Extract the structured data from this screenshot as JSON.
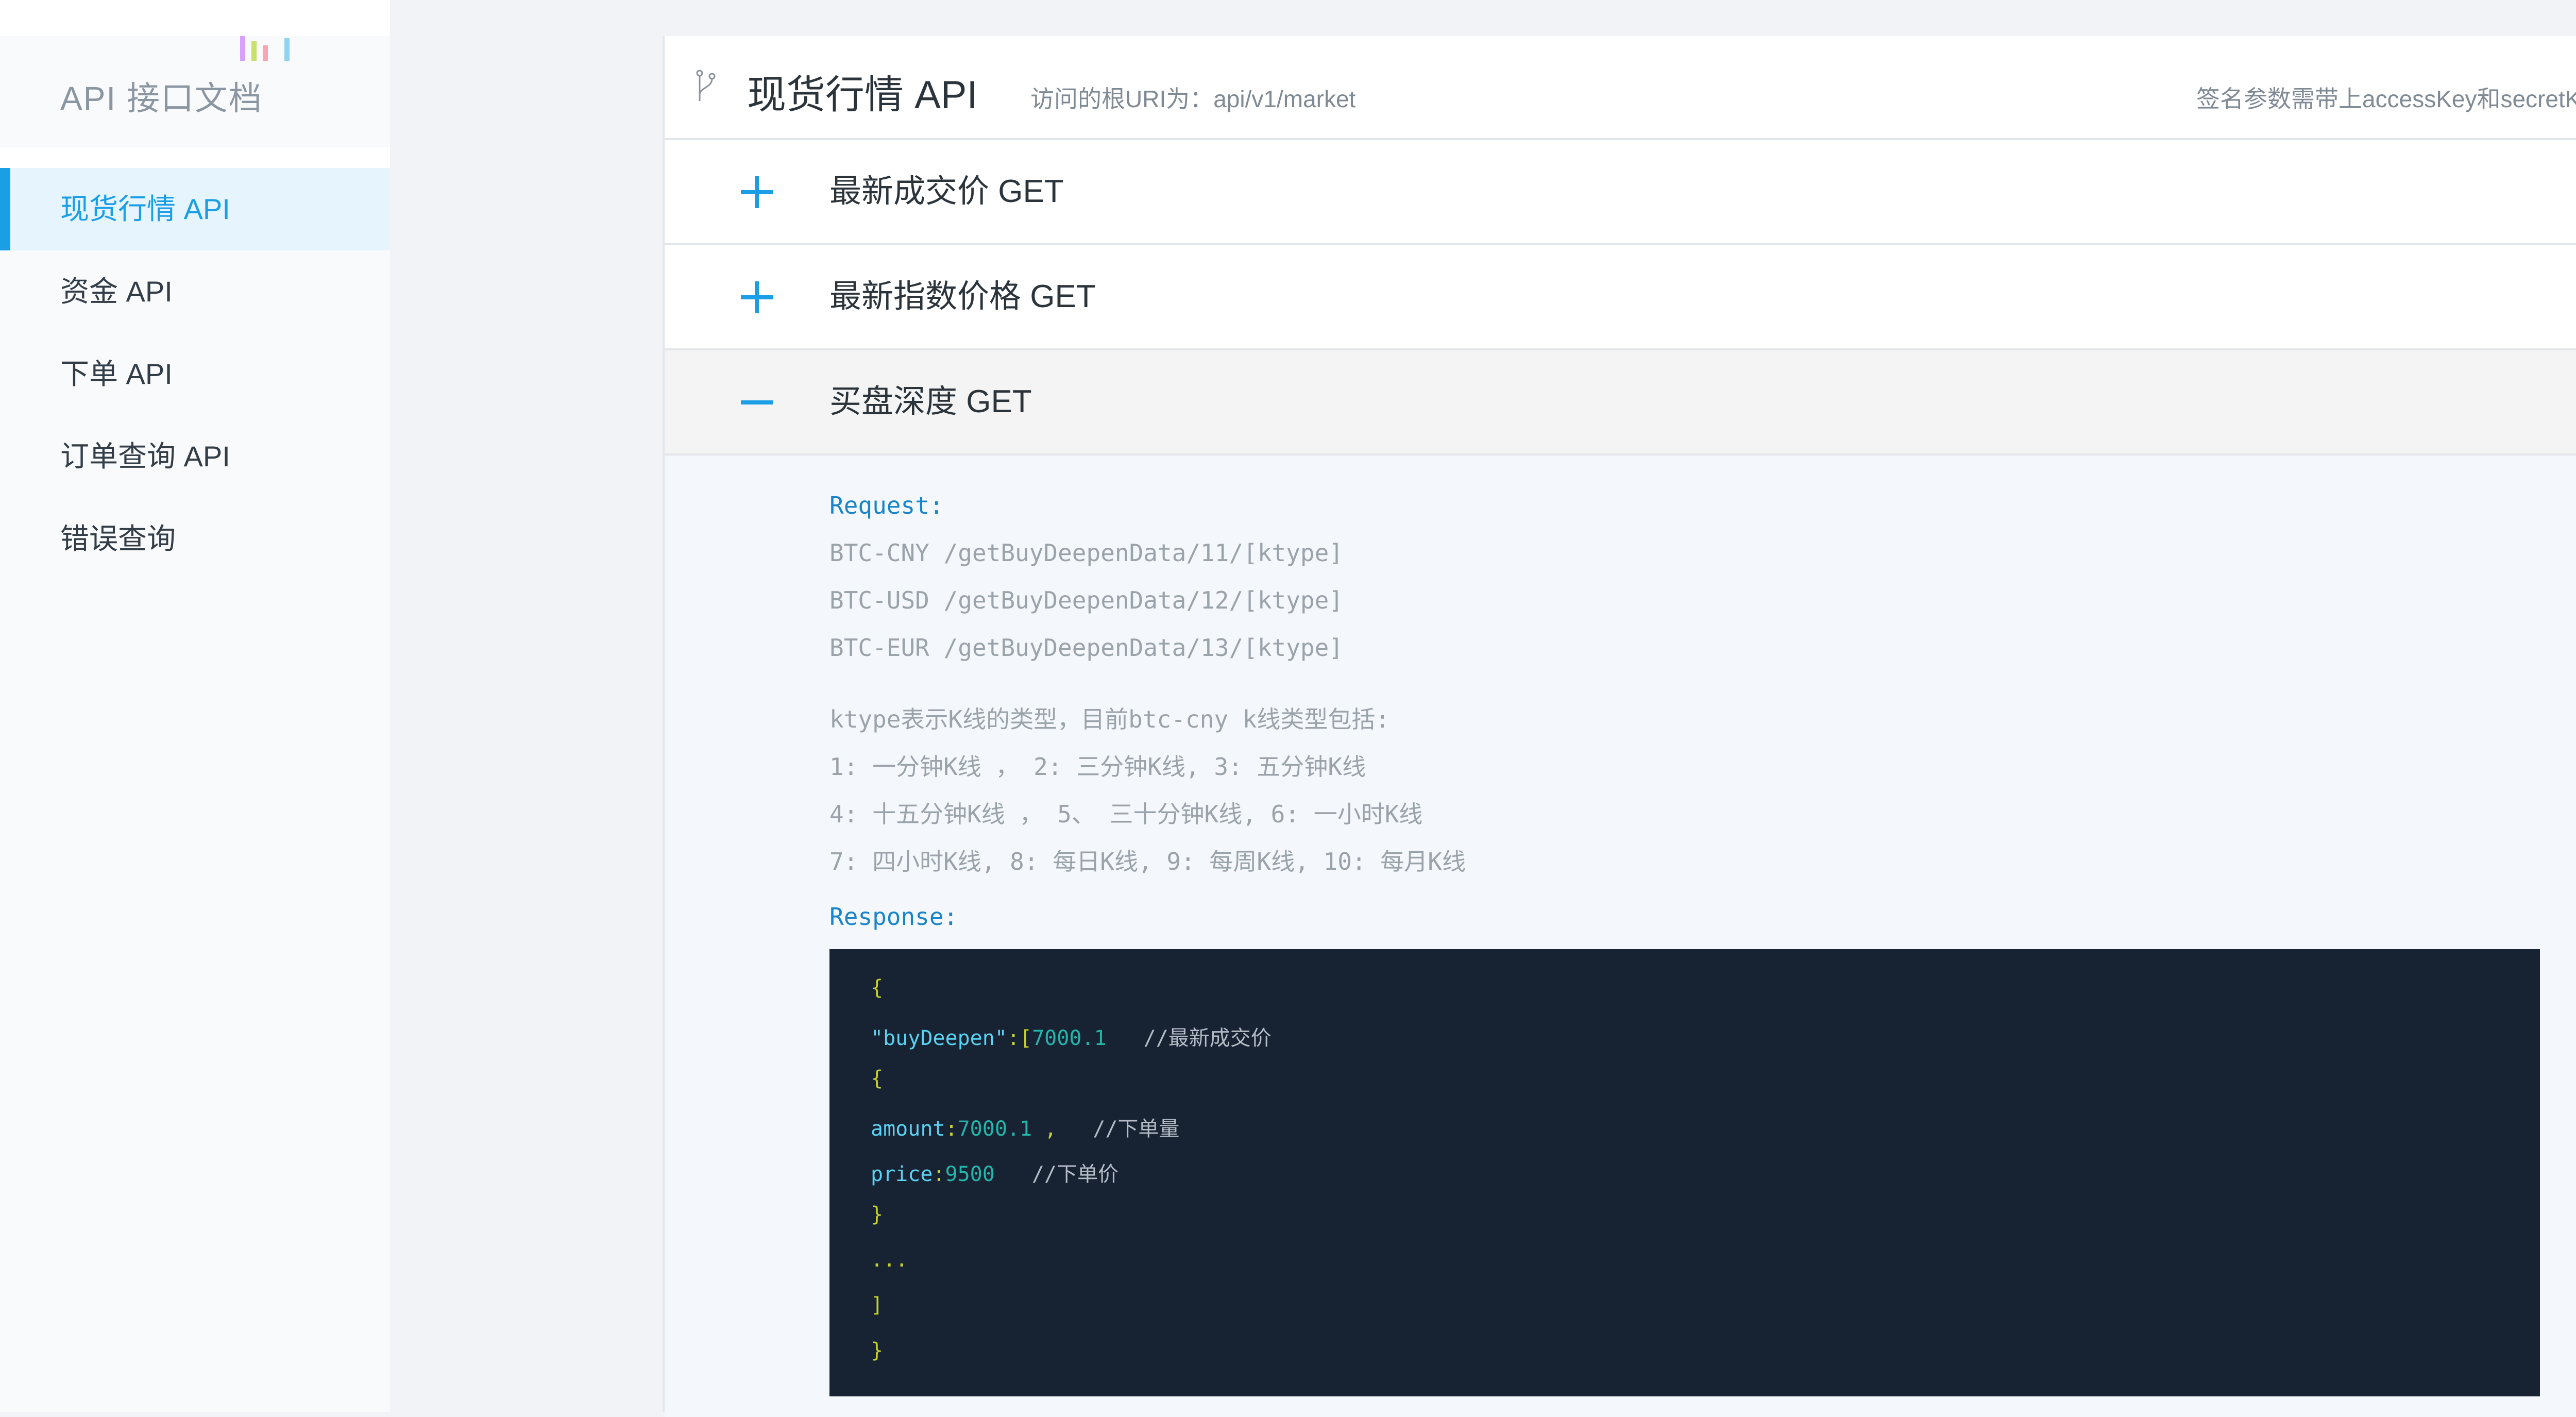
{
  "sidebar": {
    "title": "API 接口文档",
    "logo_colors": [
      "#d7a1ff",
      "#c9e06a",
      "#f7a6b4",
      "#8fd3ef"
    ],
    "items": [
      {
        "label": "现货行情 API",
        "active": true
      },
      {
        "label": "资金 API",
        "active": false
      },
      {
        "label": "下单 API",
        "active": false
      },
      {
        "label": "订单查询 API",
        "active": false
      },
      {
        "label": "错误查询",
        "active": false
      }
    ]
  },
  "header": {
    "icon": "branch-icon",
    "title": "现货行情 API",
    "root_uri": "访问的根URI为：api/v1/market",
    "sign_hint": "签名参数需带上accessKey和secretKey"
  },
  "accordion": [
    {
      "label": "最新成交价 GET",
      "expanded": false,
      "icon": "plus-icon"
    },
    {
      "label": "最新指数价格 GET",
      "expanded": false,
      "icon": "plus-icon"
    },
    {
      "label": "买盘深度 GET",
      "expanded": true,
      "icon": "minus-icon"
    }
  ],
  "detail": {
    "request_label": "Request:",
    "request_lines": [
      "BTC-CNY /getBuyDeepenData/11/[ktype]",
      "BTC-USD /getBuyDeepenData/12/[ktype]",
      "BTC-EUR /getBuyDeepenData/13/[ktype]"
    ],
    "notes": [
      "ktype表示K线的类型，目前btc-cny k线类型包括:",
      "1: 一分钟K线 ， 2: 三分钟K线, 3: 五分钟K线",
      "4: 十五分钟K线 ， 5、 三十分钟K线, 6: 一小时K线",
      "7: 四小时K线, 8: 每日K线, 9: 每周K线, 10: 每月K线"
    ],
    "response_label": "Response:",
    "code": {
      "open_brace": "{",
      "buy_key": "\"buyDeepen\"",
      "buy_punct": ":[",
      "buy_value": "7000.1",
      "buy_comment": "//最新成交价",
      "inner_open": "{",
      "amount_key": "amount",
      "amount_punct": ":",
      "amount_value": "7000.1",
      "amount_sep": " ,",
      "amount_comment": "//下单量",
      "price_key": "price",
      "price_punct": ":",
      "price_value": "9500",
      "price_comment": "//下单价",
      "inner_close": "}",
      "ellipsis": "...",
      "array_close": "]",
      "close_brace": "}"
    }
  }
}
